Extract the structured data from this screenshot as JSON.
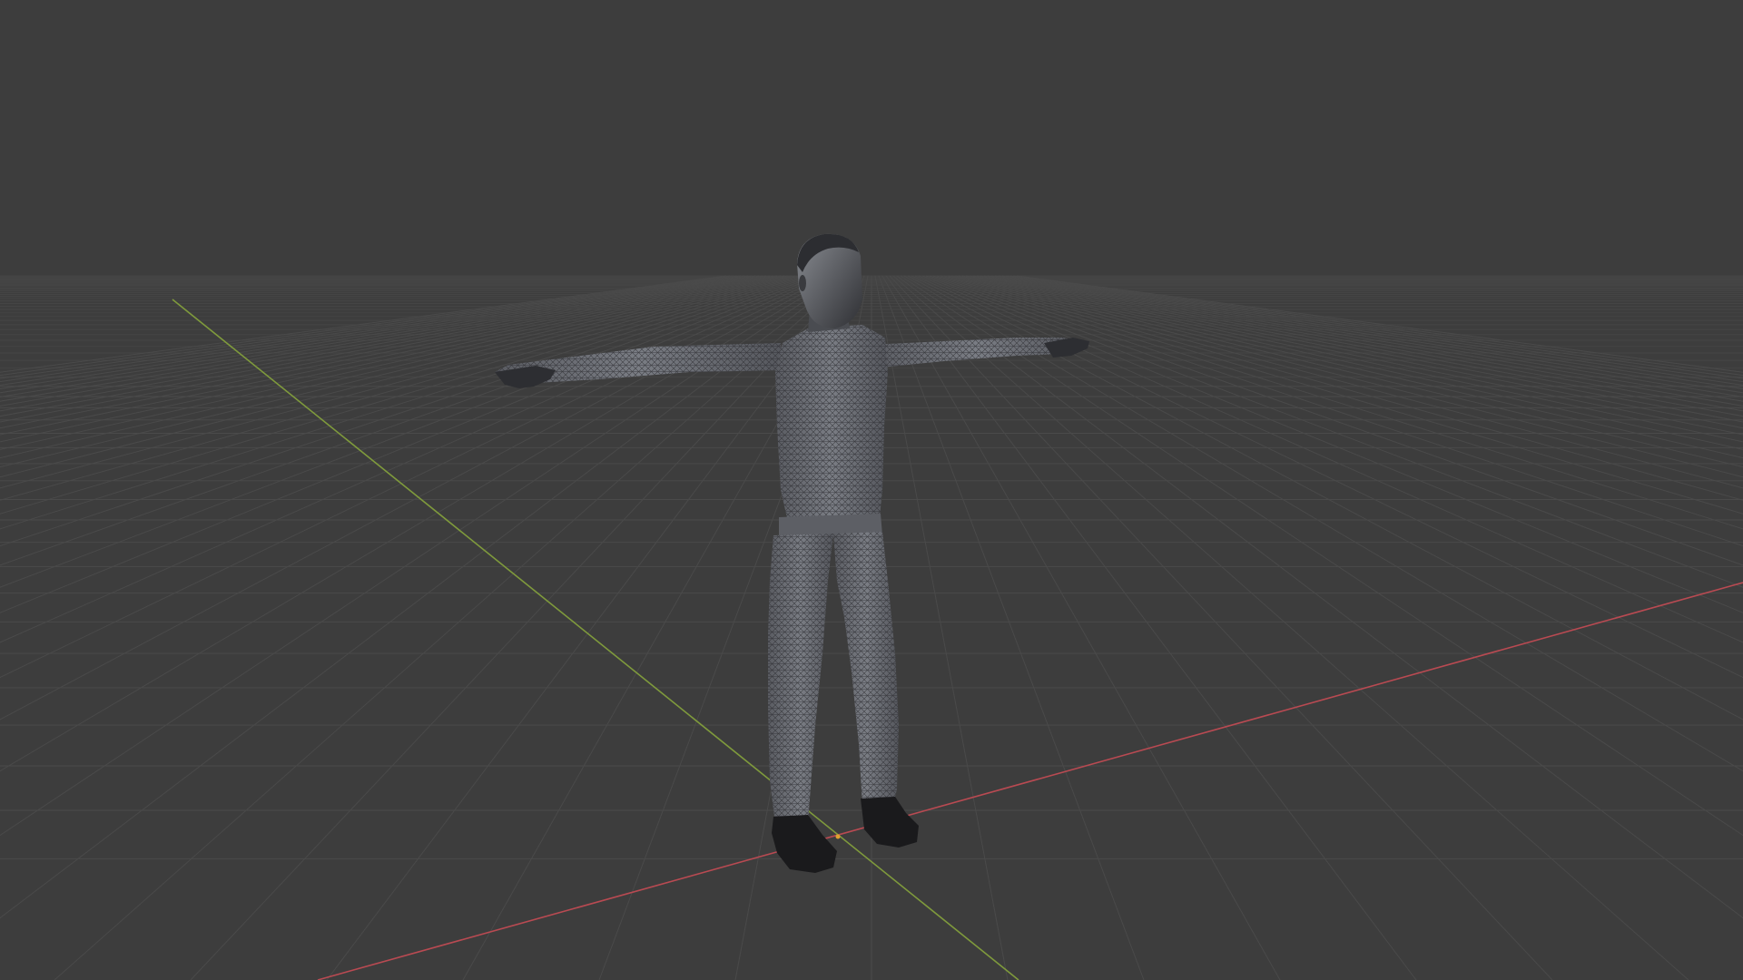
{
  "viewport": {
    "background_color": "#3d3d3d",
    "grid_line_color": "#4a4a4a",
    "grid_line_far_color": "#454545",
    "x_axis_color": "#b94a52",
    "y_axis_color": "#7f9a3c",
    "origin_marker_color": "#e0a030"
  },
  "object": {
    "kind": "humanoid-mesh-t-pose",
    "shading": "solid-with-wireframe",
    "base_color": "#6a6c72",
    "wire_color": "#2a2b2e",
    "shoe_color": "#1a1a1c"
  }
}
